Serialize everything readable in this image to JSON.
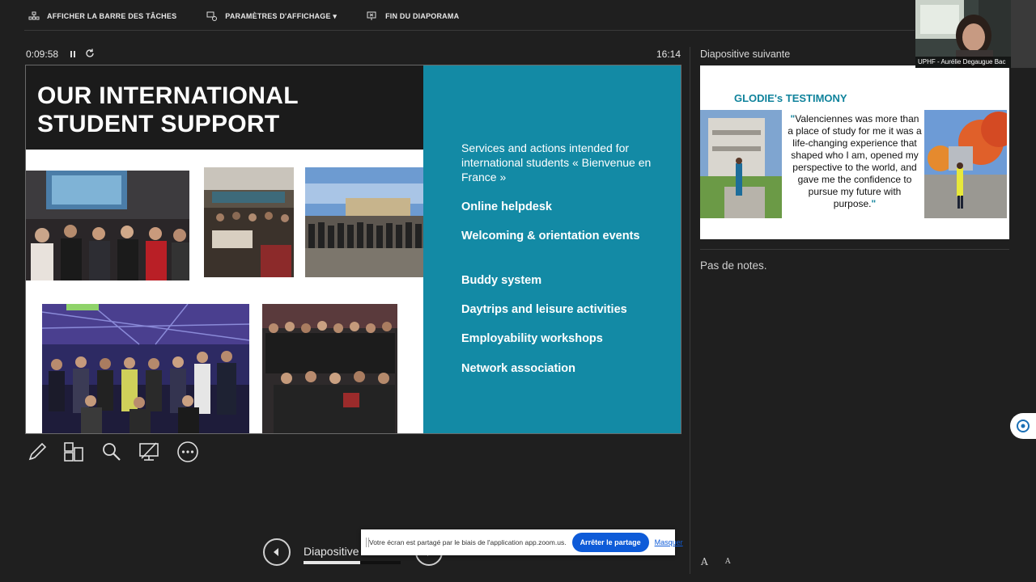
{
  "toolbar": {
    "show_taskbar": "AFFICHER LA BARRE DES TÂCHES",
    "display_settings": "PARAMÈTRES D'AFFICHAGE ▾",
    "end_slideshow": "FIN DU DIAPORAMA"
  },
  "presenter": {
    "elapsed_time": "0:09:58",
    "clock": "16:14"
  },
  "slide": {
    "title_line1": "OUR INTERNATIONAL",
    "title_line2": "STUDENT SUPPORT",
    "intro": "Services and actions intended for international students « Bienvenue en France »",
    "services": [
      "Online helpdesk",
      "Welcoming & orientation events",
      "Buddy system",
      "Daytrips and leisure activities",
      "Employability workshops",
      "Network association"
    ],
    "colors": {
      "band": "#1b1b1b",
      "panel": "#138aa5"
    }
  },
  "next": {
    "label": "Diapositive suivante",
    "title": "GLODIE's TESTIMONY",
    "quote_open": "\"",
    "quote": "Valenciennes was more than a place of study for me  it was a life-changing experience that shaped who I am, opened my perspective to the world, and gave me the confidence to pursue my future with purpose.",
    "quote_close": "\""
  },
  "notes": {
    "text": "Pas de notes."
  },
  "webcam": {
    "name": "UPHF - Aurélie Degaugue Bac"
  },
  "nav": {
    "slide_label": "Diapositive",
    "progress_fraction": 0.58
  },
  "share_banner": {
    "message": "Votre écran est partagé par le biais de l'application app.zoom.us.",
    "stop": "Arrêter le partage",
    "hide": "Masquer"
  },
  "font_controls": {
    "increase": "A",
    "decrease": "A"
  }
}
